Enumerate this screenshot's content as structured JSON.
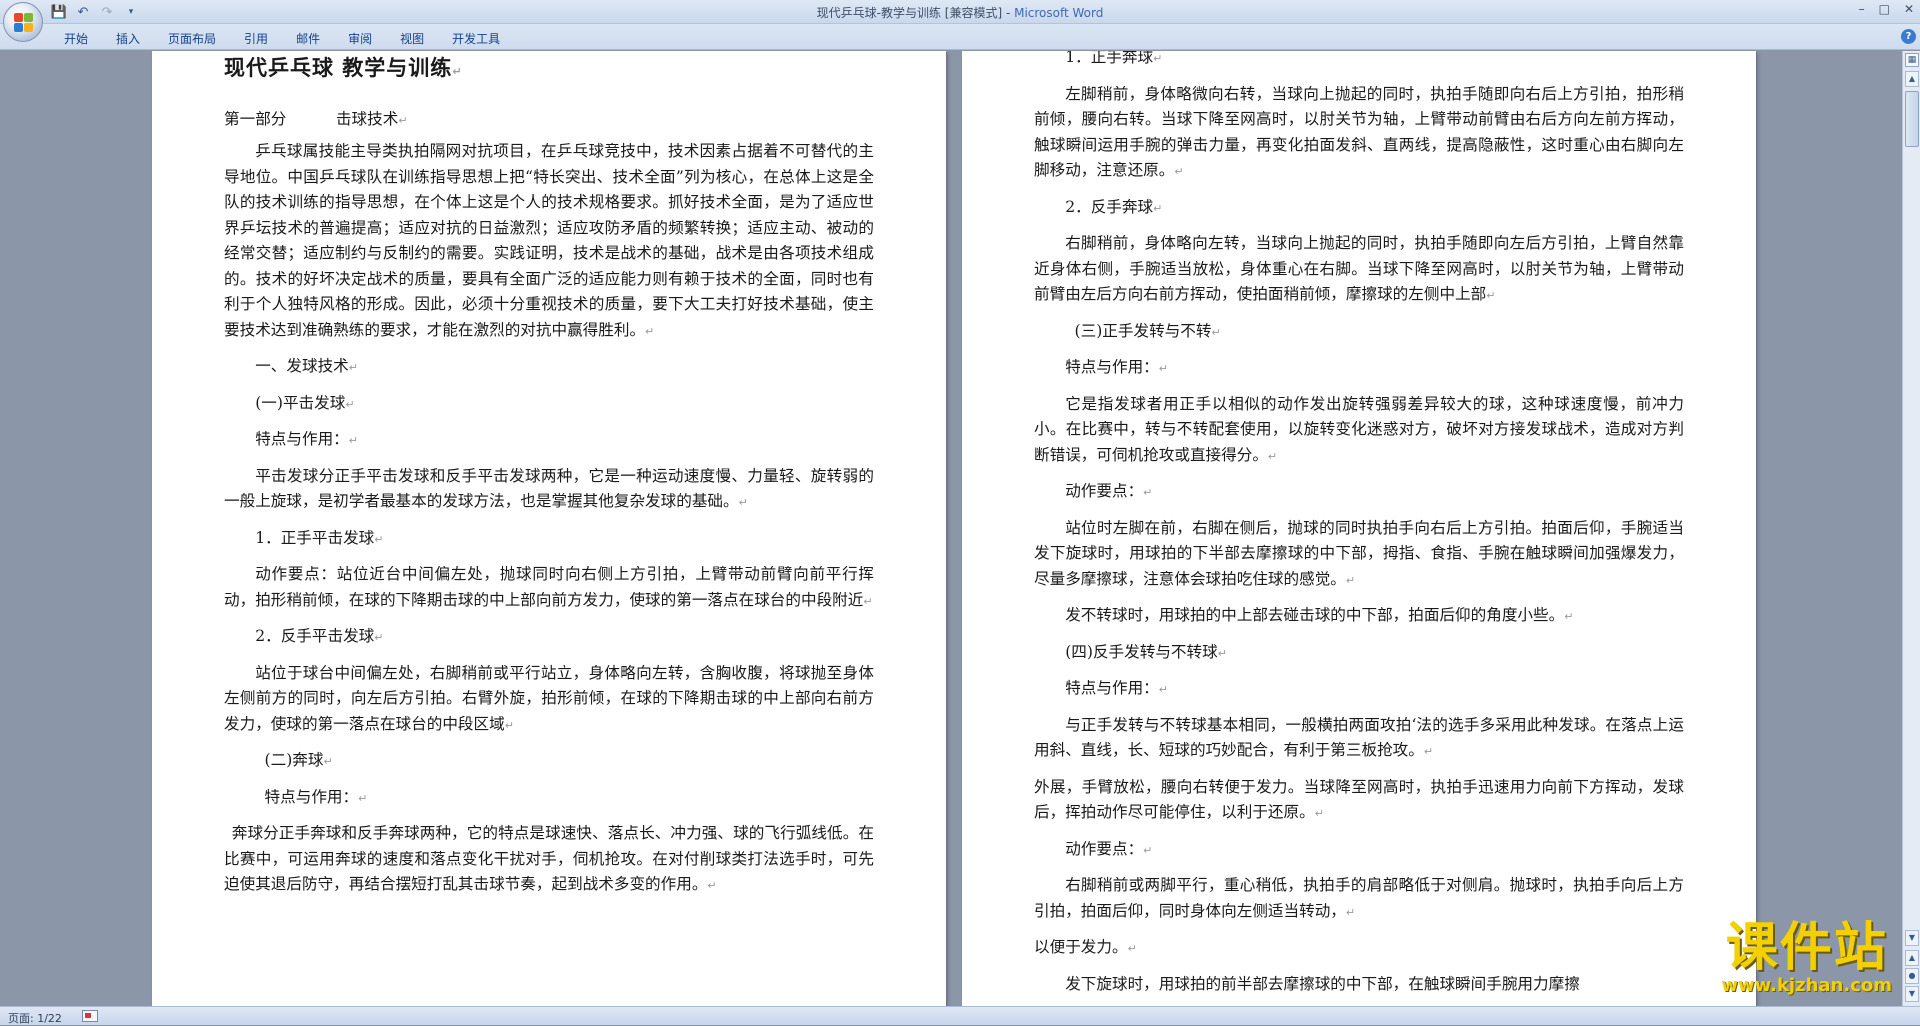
{
  "window": {
    "title_doc": "现代乒乓球-教学与训练 [兼容模式] - ",
    "title_app": "Microsoft Word"
  },
  "quick_access": {
    "save_icon": "save-icon",
    "undo_icon": "undo-icon",
    "redo_icon": "redo-icon",
    "customize_icon": "chevron-down-icon"
  },
  "ribbon_tabs": [
    "开始",
    "插入",
    "页面布局",
    "引用",
    "邮件",
    "审阅",
    "视图",
    "开发工具"
  ],
  "status": {
    "page_info": "页面: 1/22"
  },
  "watermark": {
    "logo_text": "课件站",
    "url": "www.kjzhan.com"
  },
  "left_page": {
    "title": "现代乒乓球  教学与训练",
    "part": "第一部分          击球技术",
    "intro": "乒乓球属技能主导类执拍隔网对抗项目，在乒乓球竞技中，技术因素占据着不可替代的主导地位。中国乒乓球队在训练指导思想上把“特长突出、技术全面”列为核心，在总体上这是全队的技术训练的指导思想，在个体上这是个人的技术规格要求。抓好技术全面，是为了适应世界乒坛技术的普遍提高；适应对抗的日益激烈；适应攻防矛盾的频繁转换；适应主动、被动的经常交替；适应制约与反制约的需要。实践证明，技术是战术的基础，战术是由各项技术组成的。技术的好坏决定战术的质量，要具有全面广泛的适应能力则有赖于技术的全面，同时也有利于个人独特风格的形成。因此，必须十分重视技术的质量，要下大工夫打好技术基础，使主要技术达到准确熟练的要求，才能在激烈的对抗中赢得胜利。",
    "s1": "一、发球技术",
    "s1a": "(一)平击发球",
    "s1a_feat": "特点与作用：",
    "s1a_text": "平击发球分正手平击发球和反手平击发球两种，它是一种运动速度慢、力量轻、旋转弱的一般上旋球，是初学者最基本的发球方法，也是掌握其他复杂发球的基础。",
    "s1a_1": "1．正手平击发球",
    "s1a_1_text": "动作要点：站位近台中间偏左处，抛球同时向右侧上方引拍，上臂带动前臂向前平行挥动，拍形稍前倾，在球的下降期击球的中上部向前方发力，使球的第一落点在球台的中段附近",
    "s1a_2": "2．反手平击发球",
    "s1a_2_text": "站位于球台中间偏左处，右脚稍前或平行站立，身体略向左转，含胸收腹，将球抛至身体左侧前方的同时，向左后方引拍。右臂外旋，拍形前倾，在球的下降期击球的中上部向右前方发力，使球的第一落点在球台的中段区域",
    "s1b": "(二)奔球",
    "s1b_feat": "特点与作用：",
    "s1b_text": "奔球分正手奔球和反手奔球两种，它的特点是球速快、落点长、冲力强、球的飞行弧线低。在比赛中，可运用奔球的速度和落点变化干扰对手，伺机抢攻。在对付削球类打法选手时，可先迫使其退后防守，再结合摆短打乱其击球节奏，起到战术多变的作用。"
  },
  "right_page": {
    "r1": "1．正手奔球",
    "r1_text": "左脚稍前，身体略微向右转，当球向上抛起的同时，执拍手随即向右后上方引拍，拍形稍前倾，腰向右转。当球下降至网高时，以肘关节为轴，上臂带动前臂由右后方向左前方挥动，触球瞬间运用手腕的弹击力量，再变化拍面发斜、直两线，提高隐蔽性，这时重心由右脚向左脚移动，注意还原。",
    "r2": "2．反手奔球",
    "r2_text": "右脚稍前，身体略向左转，当球向上抛起的同时，执拍手随即向左后方引拍，上臂自然靠近身体右侧，手腕适当放松，身体重心在右脚。当球下降至网高时，以肘关节为轴，上臂带动前臂由左后方向右前方挥动，使拍面稍前倾，摩擦球的左侧中上部",
    "r3": "(三)正手发转与不转",
    "r3_feat": "特点与作用：",
    "r3_text": "它是指发球者用正手以相似的动作发出旋转强弱差异较大的球，这种球速度慢，前冲力小。在比赛中，转与不转配套使用，以旋转变化迷惑对方，破坏对方接发球战术，造成对方判断错误，可伺机抢攻或直接得分。",
    "r3_action": "动作要点：",
    "r3_action_text": "站位时左脚在前，右脚在侧后，抛球的同时执拍手向右后上方引拍。拍面后仰，手腕适当发下旋球时，用球拍的下半部去摩擦球的中下部，拇指、食指、手腕在触球瞬间加强爆发力，尽量多摩擦球，注意体会球拍吃住球的感觉。",
    "r3_no_spin": "发不转球时，用球拍的中上部去碰击球的中下部，拍面后仰的角度小些。",
    "r4": "(四)反手发转与不转球",
    "r4_feat": "特点与作用：",
    "r4_text": "与正手发转与不转球基本相同，一般横拍两面攻拍‘法的选手多采用此种发球。在落点上运用斜、直线，长、短球的巧妙配合，有利于第三板抢攻。",
    "r4_text2": "外展，手臂放松，腰向右转便于发力。当球降至网高时，执拍手迅速用力向前下方挥动，发球后，挥拍动作尽可能停住，以利于还原。",
    "r4_action": "动作要点：",
    "r4_action_text": "右脚稍前或两脚平行，重心稍低，执拍手的肩部略低于对侧肩。抛球时，执拍手向后上方引拍，拍面后仰，同时身体向左侧适当转动，",
    "r4_action_text2": "以便于发力。",
    "r4_last": "发下旋球时，用球拍的前半部去摩擦球的中下部，在触球瞬间手腕用力摩擦"
  }
}
